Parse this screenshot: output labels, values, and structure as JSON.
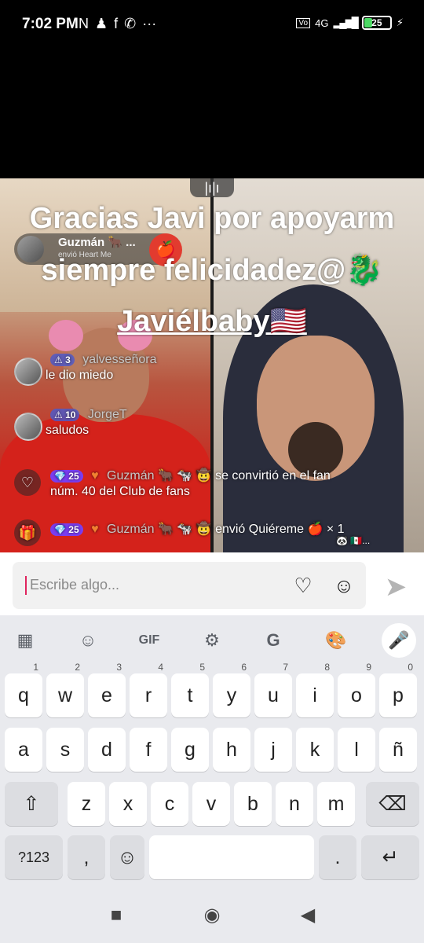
{
  "status_bar": {
    "time": "7:02 PM",
    "left_icons": [
      "nfc-icon",
      "person-add-icon",
      "facebook-icon",
      "whatsapp-icon",
      "more-icon"
    ],
    "left_glyphs": [
      "N",
      "♟",
      "f",
      "✆",
      "···"
    ],
    "network": "4G",
    "battery": "25"
  },
  "live": {
    "live_indicator": "|ı|ı",
    "caption_lines": [
      "Gracias Javi por apoyarm",
      "siempre felicidadez@🐉",
      "Javiélbaby🇺🇸"
    ],
    "host": {
      "name": "Guzmán 🐂 ...",
      "subtitle": "envió Heart Me"
    },
    "chat": [
      {
        "level": "⚠ 3",
        "user": "yalvesseñora",
        "message": "le dio miedo"
      },
      {
        "level": "⚠ 10",
        "user": "JorgeT",
        "message": "saludos"
      }
    ],
    "system_messages": [
      {
        "icon": "heart-icon",
        "icon_glyph": "♡",
        "level": "💎 25",
        "user": "Guzmán 🐂 🐄 🤠",
        "text": "se convirtió en el fan",
        "text2": "núm. 40 del Club de fans"
      },
      {
        "icon": "gift-icon",
        "icon_glyph": "🎁",
        "level": "💎 25",
        "user": "Guzmán 🐂 🐄 🤠",
        "text": "envió Quiéreme 🍎 × 1",
        "text2": "🐼 🇲🇽..."
      }
    ]
  },
  "input": {
    "placeholder": "Escribe algo...",
    "heart_glyph": "♡",
    "emoji_glyph": "☺",
    "send_glyph": "➤"
  },
  "keyboard": {
    "toolbar": [
      {
        "name": "apps-grid-icon",
        "glyph": "▦"
      },
      {
        "name": "sticker-icon",
        "glyph": "☺"
      },
      {
        "name": "gif-icon",
        "glyph": "GIF"
      },
      {
        "name": "settings-gear-icon",
        "glyph": "⚙"
      },
      {
        "name": "translate-icon",
        "glyph": "G"
      },
      {
        "name": "theme-palette-icon",
        "glyph": "🎨"
      }
    ],
    "mic_glyph": "🎤",
    "row1": [
      {
        "key": "q",
        "hint": "1"
      },
      {
        "key": "w",
        "hint": "2"
      },
      {
        "key": "e",
        "hint": "3"
      },
      {
        "key": "r",
        "hint": "4"
      },
      {
        "key": "t",
        "hint": "5"
      },
      {
        "key": "y",
        "hint": "6"
      },
      {
        "key": "u",
        "hint": "7"
      },
      {
        "key": "i",
        "hint": "8"
      },
      {
        "key": "o",
        "hint": "9"
      },
      {
        "key": "p",
        "hint": "0"
      }
    ],
    "row2": [
      "a",
      "s",
      "d",
      "f",
      "g",
      "h",
      "j",
      "k",
      "l",
      "ñ"
    ],
    "row3": [
      "z",
      "x",
      "c",
      "v",
      "b",
      "n",
      "m"
    ],
    "shift": "⇧",
    "backspace": "⌫",
    "symbols": "?123",
    "comma": ",",
    "emoji": "☺",
    "period": ".",
    "enter": "↵"
  },
  "navbar": {
    "recent": "■",
    "home": "◉",
    "back": "◀"
  }
}
